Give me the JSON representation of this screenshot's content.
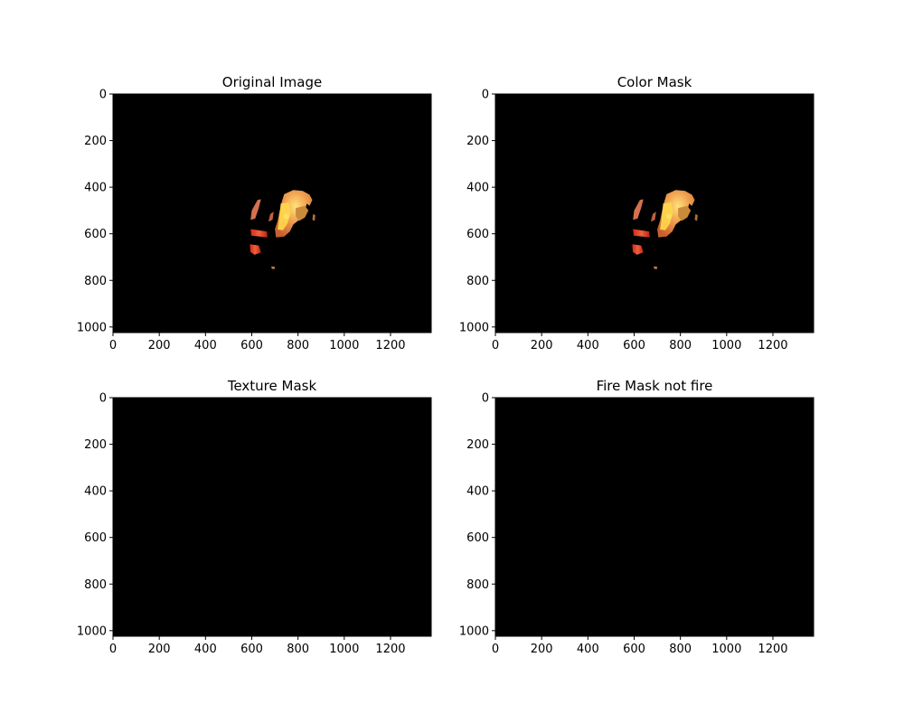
{
  "chart_data": [
    {
      "type": "heatmap",
      "title": "Original Image",
      "image_content": "fire-blobs",
      "xlim": [
        0,
        1376
      ],
      "ylim": [
        1024,
        0
      ],
      "xticks": [
        0,
        200,
        400,
        600,
        800,
        1000,
        1200
      ],
      "yticks": [
        0,
        200,
        400,
        600,
        800,
        1000
      ],
      "grid": false
    },
    {
      "type": "heatmap",
      "title": "Color Mask",
      "image_content": "fire-blobs",
      "xlim": [
        0,
        1376
      ],
      "ylim": [
        1024,
        0
      ],
      "xticks": [
        0,
        200,
        400,
        600,
        800,
        1000,
        1200
      ],
      "yticks": [
        0,
        200,
        400,
        600,
        800,
        1000
      ],
      "grid": false
    },
    {
      "type": "heatmap",
      "title": "Texture Mask",
      "image_content": "empty",
      "xlim": [
        0,
        1376
      ],
      "ylim": [
        1024,
        0
      ],
      "xticks": [
        0,
        200,
        400,
        600,
        800,
        1000,
        1200
      ],
      "yticks": [
        0,
        200,
        400,
        600,
        800,
        1000
      ],
      "grid": false
    },
    {
      "type": "heatmap",
      "title": "Fire Mask not fire",
      "image_content": "empty",
      "xlim": [
        0,
        1376
      ],
      "ylim": [
        1024,
        0
      ],
      "xticks": [
        0,
        200,
        400,
        600,
        800,
        1000,
        1200
      ],
      "yticks": [
        0,
        200,
        400,
        600,
        800,
        1000
      ],
      "grid": false
    }
  ],
  "colors": {
    "image_background": "#000000",
    "fire_outer": "#c8502a",
    "fire_mid": "#e88a40",
    "fire_bright": "#ffd24a",
    "fire_red": "#d42a14"
  }
}
